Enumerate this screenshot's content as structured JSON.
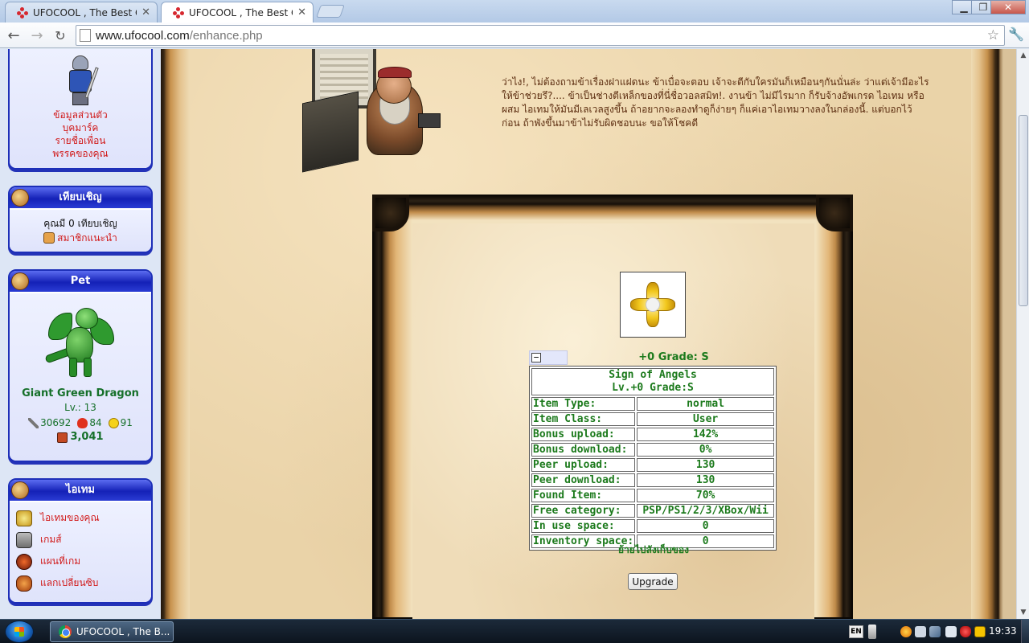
{
  "browser": {
    "tabs": [
      {
        "title": "UFOCOOL , The Best Cor"
      },
      {
        "title": "UFOCOOL , The Best Cor"
      }
    ],
    "url_host": "www.ufocool.com",
    "url_path": "/enhance.php"
  },
  "sidebar": {
    "profile_links": [
      "ข้อมูลส่วนตัว",
      "บุคมาร์ค",
      "รายชื่อเพื่อน",
      "พรรคของคุณ"
    ],
    "invite": {
      "title": "เทียบเชิญ",
      "count_text": "คุณมี 0 เทียบเชิญ",
      "link": "สมาชิกแนะนำ"
    },
    "pet": {
      "title": "Pet",
      "name": "Giant Green Dragon",
      "level": "Lv.: 13",
      "attack": "30692",
      "hp": "84",
      "happiness": "91",
      "power": "3,041"
    },
    "items": {
      "title": "ไอเทม",
      "links": [
        "ไอเทมของคุณ",
        "เกมส์",
        "แผนที่เกม",
        "แลกเปลี่ยนซิบ"
      ]
    }
  },
  "main": {
    "speech": "ว่าไง!, ไม่ต้องถามข้าเรื่องฝาแฝดนะ ข้าเบื่อจะตอบ เจ้าจะตีกับใครมันก็เหมือนๆกันนั่นล่ะ ว่าแต่เจ้ามีอะไรให้ข้าช่วยรึ?.... ข้าเป็นช่างตีเหล็กของที่นี่ชื่อวอลสมิท!. งานข้า ไม่มีไรมาก ก็รับจ้างอัพเกรด ไอเทม หรือผสม ไอเทมให้มันมีเลเวลสูงขึ้น ถ้าอยากจะลองทำดูก็ง่ายๆ ก็แค่เอาไอเทมวางลงในกล่องนี้. แต่บอกไว้ก่อน ถ้าพังขึ้นมาข้าไม่รับผิดชอบนะ ขอให้โชคดี",
    "collapse_symbol": "−",
    "item_grade_title": "+0 Grade: S",
    "item_name": "Sign of Angels",
    "item_level": "Lv.+0 Grade:S",
    "stats": [
      {
        "label": "Item Type:",
        "value": "normal"
      },
      {
        "label": "Item Class:",
        "value": "User"
      },
      {
        "label": "Bonus upload:",
        "value": "142%"
      },
      {
        "label": "Bonus download:",
        "value": "0%"
      },
      {
        "label": "Peer upload:",
        "value": "130"
      },
      {
        "label": "Peer download:",
        "value": "130"
      },
      {
        "label": "Found Item:",
        "value": "70%"
      },
      {
        "label": "Free category:",
        "value": "PSP/PS1/2/3/XBox/Wii"
      },
      {
        "label": "In use space:",
        "value": "0"
      },
      {
        "label": "Inventory space:",
        "value": "0"
      }
    ],
    "move_link": "ย้ายไปลังเก็บของ",
    "upgrade_label": "Upgrade"
  },
  "taskbar": {
    "task_label": "UFOCOOL , The B...",
    "lang": "EN",
    "clock": "19:33"
  }
}
